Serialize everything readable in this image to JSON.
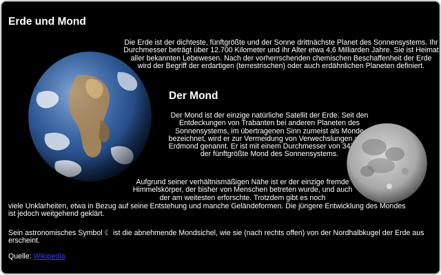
{
  "page": {
    "title": "Erde und Mond",
    "intro": "Die Erde ist der dichteste, fünftgrößte und der Sonne drittnächste Planet des Sonnensystems. Ihr Durchmesser beträgt über 12.700 Kilometer und ihr Alter etwa 4,6 Milliarden Jahre. Sie ist Heimat aller bekannten Lebewesen. Nach der vorherrschenden chemischen Beschaffenheit der Erde wird der Begriff der erdartigen (terrestrischen) oder auch erdähnlichen Planeten definiert.",
    "moon_heading": "Der Mond",
    "moon_p1": "Der Mond ist der einzige natürliche Satellit der Erde. Seit den Entdeckungen von Trabanten bei anderen Planeten des Sonnensystems, im übertragenen Sinn zumeist als Monde bezeichnet, wird er zur Vermeidung von Verwechslungen auch Erdmond genannt. Er ist mit einem Durchmesser von 3476 km der fünftgrößte Mond des Sonnensystems.",
    "moon_p2a": "Aufgrund seiner verhältnismäßigen Nähe ist er der einzige fremde Himmelskörper, der bisher von Menschen betreten wurde, und auch der am weitesten erforschte. Trotzdem gibt es noch",
    "moon_p2b": "viele Unklarheiten, etwa in Bezug auf seine Entstehung und manche Geländeformen. Die jüngere Entwicklung des Mondes ist jedoch weitgehend geklärt.",
    "symbol_text": "Sein astronomisches Symbol ☾ ist die abnehmende Mondsichel, wie sie (nach rechts offen) von der Nordhalbkugel der Erde aus erscheint.",
    "source_label": "Quelle:",
    "source_link": "Wikipedia"
  },
  "images": {
    "earth": "earth-globe-image",
    "moon": "full-moon-image"
  },
  "colors": {
    "background": "#000000",
    "text": "#ffffff",
    "link": "#3b3bff"
  }
}
